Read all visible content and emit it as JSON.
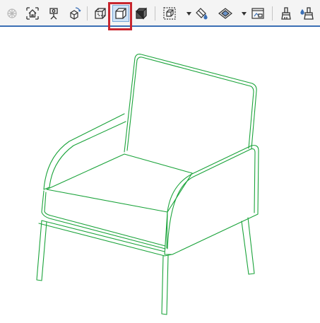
{
  "toolbar": {
    "tools": [
      {
        "name": "grid-view-icon",
        "state": "disabled"
      },
      {
        "name": "home-view-icon",
        "state": "normal"
      },
      {
        "name": "camera-walk-icon",
        "state": "normal"
      },
      {
        "name": "orbit-3d-icon",
        "state": "normal"
      },
      {
        "name": "wireframe-mode-icon",
        "state": "normal"
      },
      {
        "name": "hidden-line-mode-icon",
        "state": "selected"
      },
      {
        "name": "shaded-mode-icon",
        "state": "normal"
      },
      {
        "name": "section-box-icon",
        "state": "normal"
      },
      {
        "name": "material-paint-icon",
        "state": "normal"
      },
      {
        "name": "surface-style-icon",
        "state": "normal"
      },
      {
        "name": "render-window-icon",
        "state": "normal"
      },
      {
        "name": "brush-icon",
        "state": "normal"
      },
      {
        "name": "brush-drop-icon",
        "state": "normal"
      }
    ],
    "selected_tool": "hidden-line-mode-icon"
  },
  "colors": {
    "toolbar_bg": "#f4f4f4",
    "toolbar_border": "#3b6fb5",
    "highlight_frame": "#c8262f",
    "active_bg": "#cfe3f7",
    "model_edges": "#1aa33a",
    "icon_dark": "#333333"
  },
  "viewport": {
    "model": "armchair",
    "render_mode": "hidden-line"
  }
}
